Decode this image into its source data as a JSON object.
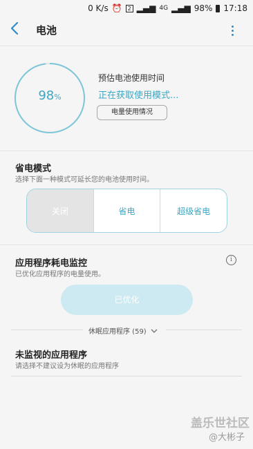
{
  "status_bar": {
    "net_speed": "0 K/s",
    "notif": "2",
    "network": "4G",
    "battery": "98%",
    "time": "17:18"
  },
  "header": {
    "title": "电池"
  },
  "battery_ring": {
    "value": "98",
    "unit": "%",
    "level": 0.98
  },
  "estimate": {
    "label": "预估电池使用时间",
    "status": "正在获取使用模式...",
    "usage_button": "电量使用情况"
  },
  "power_mode": {
    "title": "省电模式",
    "subtitle": "选择下面一种模式可延长您的电池使用时间。",
    "options": [
      "关闭",
      "省电",
      "超级省电"
    ],
    "selected_index": 0
  },
  "app_monitor": {
    "title": "应用程序耗电监控",
    "subtitle": "已优化应用程序的电量使用。",
    "optimize_button": "已优化",
    "sleeping_apps": "休眠应用程序 (59)"
  },
  "unmonitored": {
    "title": "未监视的应用程序",
    "subtitle": "请选择不建议设为休眠的应用程序"
  },
  "watermark": {
    "line1": "盖乐世社区",
    "line2": "@大彬子"
  },
  "colors": {
    "accent": "#3aa8c4",
    "link": "#2f8bc5",
    "background": "#f5f5f5"
  }
}
